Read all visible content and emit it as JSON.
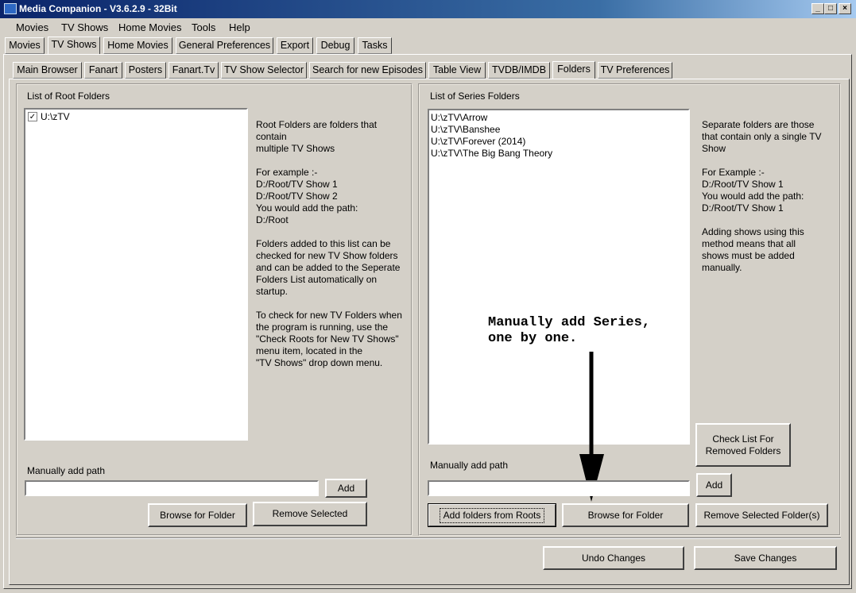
{
  "window": {
    "title": "Media Companion - V3.6.2.9 - 32Bit",
    "minimize_glyph": "_",
    "maximize_glyph": "□",
    "close_glyph": "×"
  },
  "menu": [
    "Movies",
    "TV Shows",
    "Home Movies",
    "Tools",
    "Help"
  ],
  "main_tabs": [
    "Movies",
    "TV Shows",
    "Home Movies",
    "General Preferences",
    "Export",
    "Debug",
    "Tasks"
  ],
  "main_tabs_active": "TV Shows",
  "sub_tabs": [
    "Main Browser",
    "Fanart",
    "Posters",
    "Fanart.Tv",
    "TV Show Selector",
    "Search for new Episodes",
    "Table View",
    "TVDB/IMDB",
    "Folders",
    "TV Preferences"
  ],
  "sub_tabs_active": "Folders",
  "root_panel": {
    "title": "List of Root Folders",
    "items": [
      {
        "label": "U:\\zTV",
        "checked": true
      }
    ],
    "help": "Root Folders are folders that\ncontain\nmultiple TV Shows\n\nFor example :-\nD:/Root/TV Show 1\nD:/Root/TV Show 2\nYou would add the path:\nD:/Root\n\nFolders added to this list can be\nchecked for new TV Show folders\nand can be added to the Seperate\nFolders List automatically on\nstartup.\n\nTo check for new TV Folders when\nthe program is running, use the\n\"Check Roots for New TV Shows\"\nmenu item, located in the\n\"TV Shows\" drop down menu.",
    "manual_label": "Manually add path",
    "path_value": "",
    "add_label": "Add",
    "browse_label": "Browse for Folder",
    "remove_label": "Remove Selected"
  },
  "series_panel": {
    "title": "List of Series Folders",
    "items": [
      "U:\\zTV\\Arrow",
      "U:\\zTV\\Banshee",
      "U:\\zTV\\Forever (2014)",
      "U:\\zTV\\The Big Bang Theory"
    ],
    "help": "Separate folders are those\nthat contain only a single TV\nShow\n\nFor Example :-\nD:/Root/TV Show 1\nYou would add the path:\nD:/Root/TV Show 1\n\nAdding shows using this\nmethod means that all\nshows must be added\nmanually.",
    "manual_label": "Manually add path",
    "path_value": "",
    "add_label": "Add",
    "check_removed_label": "Check List For\nRemoved Folders",
    "add_from_roots_label": "Add folders from Roots",
    "browse_label": "Browse for Folder",
    "remove_label": "Remove Selected Folder(s)"
  },
  "annotation": "Manually add Series,\none by one.",
  "footer": {
    "undo_label": "Undo Changes",
    "save_label": "Save Changes"
  }
}
